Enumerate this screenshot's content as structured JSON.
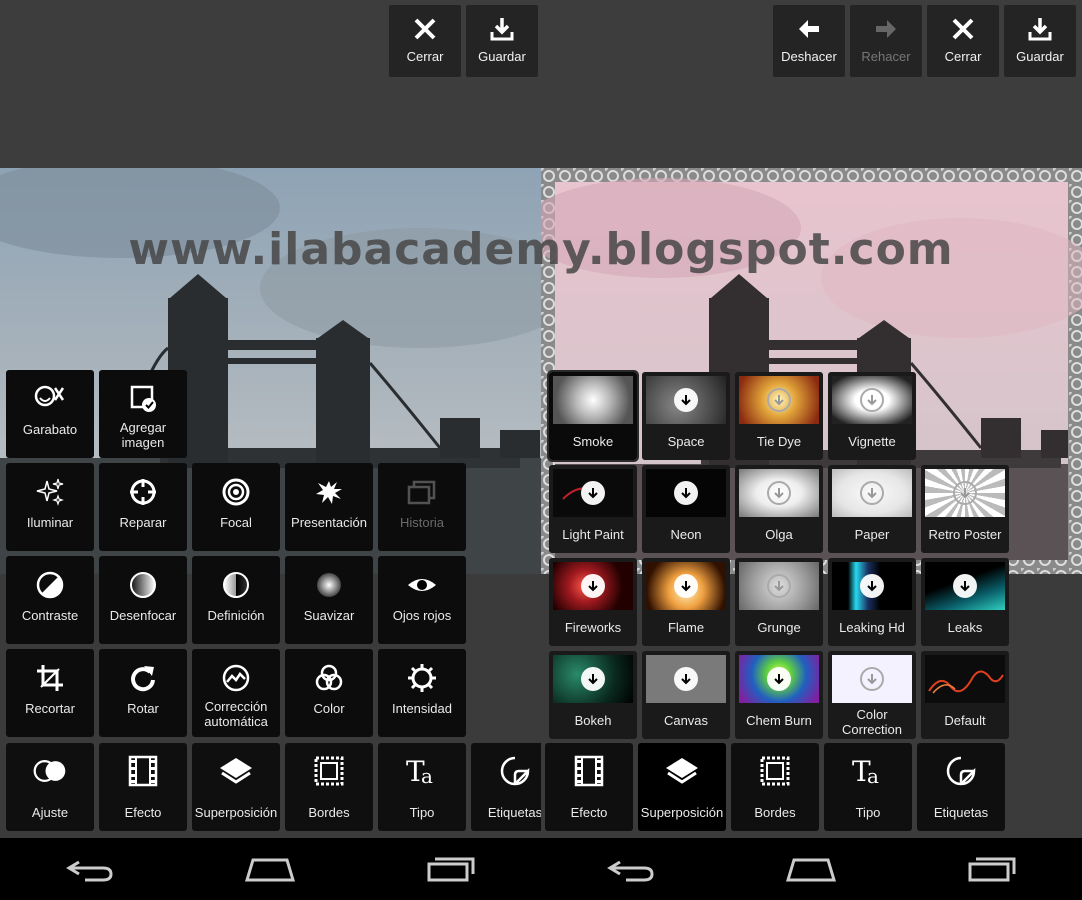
{
  "watermark": "www.ilabacademy.blogspot.com",
  "left": {
    "topbar": {
      "close_label": "Cerrar",
      "save_label": "Guardar"
    },
    "tools": {
      "garabato": "Garabato",
      "agregar_imagen": "Agregar imagen",
      "iluminar": "Iluminar",
      "reparar": "Reparar",
      "focal": "Focal",
      "presentacion": "Presentación",
      "historia": "Historia",
      "contraste": "Contraste",
      "desenfocar": "Desenfocar",
      "definicion": "Definición",
      "suavizar": "Suavizar",
      "ojos_rojos": "Ojos rojos",
      "recortar": "Recortar",
      "rotar": "Rotar",
      "correccion": "Corrección automática",
      "color": "Color",
      "intensidad": "Intensidad"
    },
    "bottom": {
      "ajuste": "Ajuste",
      "efecto": "Efecto",
      "superposicion": "Superposición",
      "bordes": "Bordes",
      "tipo": "Tipo",
      "etiquetas": "Etiquetas"
    }
  },
  "right": {
    "topbar": {
      "undo_label": "Deshacer",
      "redo_label": "Rehacer",
      "close_label": "Cerrar",
      "save_label": "Guardar"
    },
    "overlays": {
      "smoke": "Smoke",
      "space": "Space",
      "tie_dye": "Tie Dye",
      "vignette": "Vignette",
      "light_paint": "Light Paint",
      "neon": "Neon",
      "olga": "Olga",
      "paper": "Paper",
      "retro_poster": "Retro Poster",
      "fireworks": "Fireworks",
      "flame": "Flame",
      "grunge": "Grunge",
      "leaking_hd": "Leaking Hd",
      "leaks": "Leaks",
      "bokeh": "Bokeh",
      "canvas": "Canvas",
      "chem_burn": "Chem Burn",
      "color_correction": "Color Correction",
      "default": "Default"
    },
    "bottom": {
      "efecto": "Efecto",
      "superposicion": "Superposición",
      "bordes": "Bordes",
      "tipo": "Tipo",
      "etiquetas": "Etiquetas"
    }
  }
}
